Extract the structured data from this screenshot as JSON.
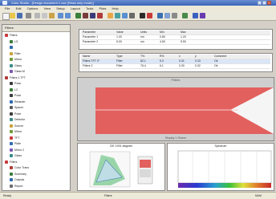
{
  "window": {
    "title": "Color Studio - [Design document 1.csd  (Read-only mode)]"
  },
  "menu": [
    "File",
    "Edit",
    "Options",
    "View",
    "Setup",
    "Layout",
    "Tools",
    "Plots",
    "Help"
  ],
  "tree": {
    "header": "Filters",
    "items": [
      {
        "label": "Filters",
        "color": "#c83a3a"
      },
      {
        "label": "LS",
        "color": "#3a7d3a"
      },
      {
        "label": "",
        "color": "#2f6ab0"
      },
      {
        "label": "Filter",
        "color": "#c8a23a"
      },
      {
        "label": "Mirror",
        "color": "#6f9a3a"
      },
      {
        "label": "Glass",
        "color": "#3a8a8a"
      },
      {
        "label": "Glass M",
        "color": "#7a5ab0"
      },
      {
        "label": "Filters 1 TFT",
        "color": "#b03a3a"
      },
      {
        "label": "Polar",
        "color": "#3a3a3a"
      },
      {
        "label": "LC",
        "color": "#3a7d3a"
      },
      {
        "label": "Polar",
        "color": "#3a3a3a"
      },
      {
        "label": "Retarder",
        "color": "#2f6ab0"
      },
      {
        "label": "Spacer",
        "color": "#5a5a5a"
      },
      {
        "label": "Polar",
        "color": "#3a3a3a"
      },
      {
        "label": "Detector",
        "color": "#3a8a8a"
      },
      {
        "label": "Source",
        "color": "#c8a23a"
      },
      {
        "label": "Mirror",
        "color": "#6f9a3a"
      },
      {
        "label": "TFT",
        "color": "#c83a3a"
      },
      {
        "label": "Plate",
        "color": "#2f6ab0"
      },
      {
        "label": "Mirror 2",
        "color": "#7a5ab0"
      },
      {
        "label": "Glass",
        "color": "#3a8a8a"
      },
      {
        "label": "Filters",
        "color": "#c83a3a"
      },
      {
        "label": "Color Trans",
        "color": "#b03a3a"
      },
      {
        "label": "Summary",
        "color": "#3a7d3a"
      },
      {
        "label": "Outputs",
        "color": "#2f6ab0"
      },
      {
        "label": "Report",
        "color": "#6a6a6a"
      }
    ]
  },
  "table1": {
    "headers": [
      "Parameter",
      "Value",
      "Units",
      "Min",
      "Max"
    ],
    "rows": [
      [
        "Parameter 1",
        "1.00",
        "nm",
        "0.80",
        "1.20"
      ],
      [
        "Parameter 2",
        "5.00",
        "nm",
        "4.50",
        "5.50"
      ]
    ]
  },
  "table2": {
    "headers": [
      "Name",
      "Type",
      "T%",
      "R%",
      "x",
      "y",
      "Comment"
    ],
    "rows": [
      [
        "Filters TFT 0°",
        "Filter",
        "82.1",
        "5.3",
        "0.31",
        "0.33",
        "Ok"
      ],
      [
        "Filters 2",
        "Filter",
        "76.4",
        "6.1",
        "0.30",
        "0.32",
        "Ok"
      ]
    ]
  },
  "viewer": {
    "title": "Filters",
    "footer": "Display 1 /Scene"
  },
  "cie": {
    "title": "CIE 1931 diagram"
  },
  "spectrum": {
    "title": "Spectrum"
  },
  "status": [
    "Ready",
    "Filters",
    "NUM"
  ]
}
